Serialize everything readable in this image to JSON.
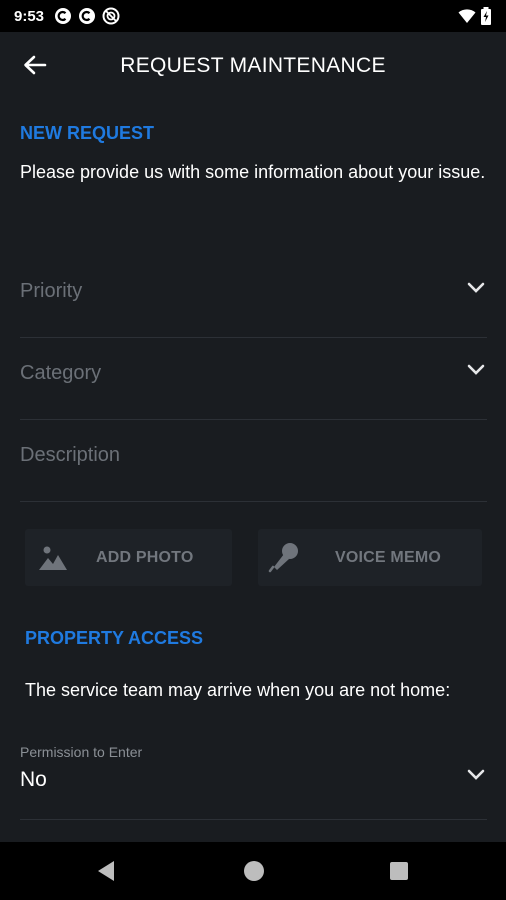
{
  "status_bar": {
    "time": "9:53",
    "left_icons": [
      "app-notification-icon",
      "app-notification-icon",
      "app-notification-icon"
    ],
    "right_icons": [
      "wifi-icon",
      "battery-charging-icon"
    ]
  },
  "app_bar": {
    "back_icon": "arrow-left-icon",
    "title": "REQUEST MAINTENANCE"
  },
  "new_request": {
    "heading": "NEW REQUEST",
    "intro": "Please provide us with some information about your issue.",
    "priority": {
      "placeholder": "Priority",
      "icon": "chevron-down-icon"
    },
    "category": {
      "placeholder": "Category",
      "icon": "chevron-down-icon"
    },
    "description": {
      "placeholder": "Description"
    },
    "add_photo": {
      "label": "ADD PHOTO",
      "icon": "image-icon"
    },
    "voice_memo": {
      "label": "VOICE MEMO",
      "icon": "microphone-icon"
    }
  },
  "property_access": {
    "heading": "PROPERTY ACCESS",
    "intro": "The service team may arrive when you are not home:",
    "permission": {
      "label": "Permission to Enter",
      "value": "No",
      "icon": "chevron-down-icon"
    }
  },
  "nav_bar": {
    "buttons": [
      "back-triangle-icon",
      "home-circle-icon",
      "recents-square-icon"
    ]
  },
  "colors": {
    "background": "#191c20",
    "accent": "#1f7ae0",
    "divider": "#2c3036",
    "placeholder": "#6b7077",
    "button_bg": "#1e2227"
  }
}
